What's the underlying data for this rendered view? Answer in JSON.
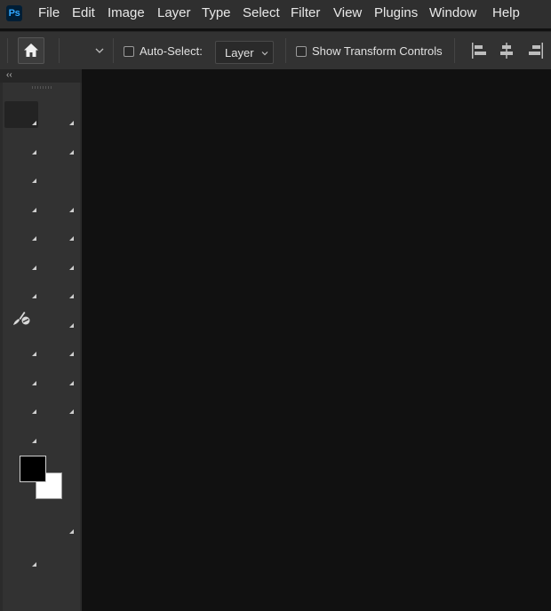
{
  "app": {
    "logo_text": "Ps",
    "logo_bg": "#001e36",
    "logo_fg": "#31a8ff"
  },
  "menubar": {
    "items": [
      "File",
      "Edit",
      "Image",
      "Layer",
      "Type",
      "Select",
      "Filter",
      "View",
      "Plugins",
      "Window",
      "Help"
    ]
  },
  "options": {
    "auto_select_label": "Auto-Select:",
    "auto_select_checked": false,
    "layer_select_value": "Layer",
    "show_transform_label": "Show Transform Controls",
    "show_transform_checked": false,
    "icons": [
      "home-icon",
      "chevron-down-icon",
      "align-left-edges-icon",
      "align-horizontal-centers-icon",
      "align-right-edges-icon"
    ]
  },
  "tools_panel": {
    "collapse_label": "‹‹",
    "visible_icons": [
      "brush-tool-icon"
    ],
    "foreground_color": "#000000",
    "background_color": "#ffffff"
  },
  "theme": {
    "menubar_bg": "#2f2f2f",
    "panel_bg": "#323232",
    "canvas_bg": "#111111"
  }
}
